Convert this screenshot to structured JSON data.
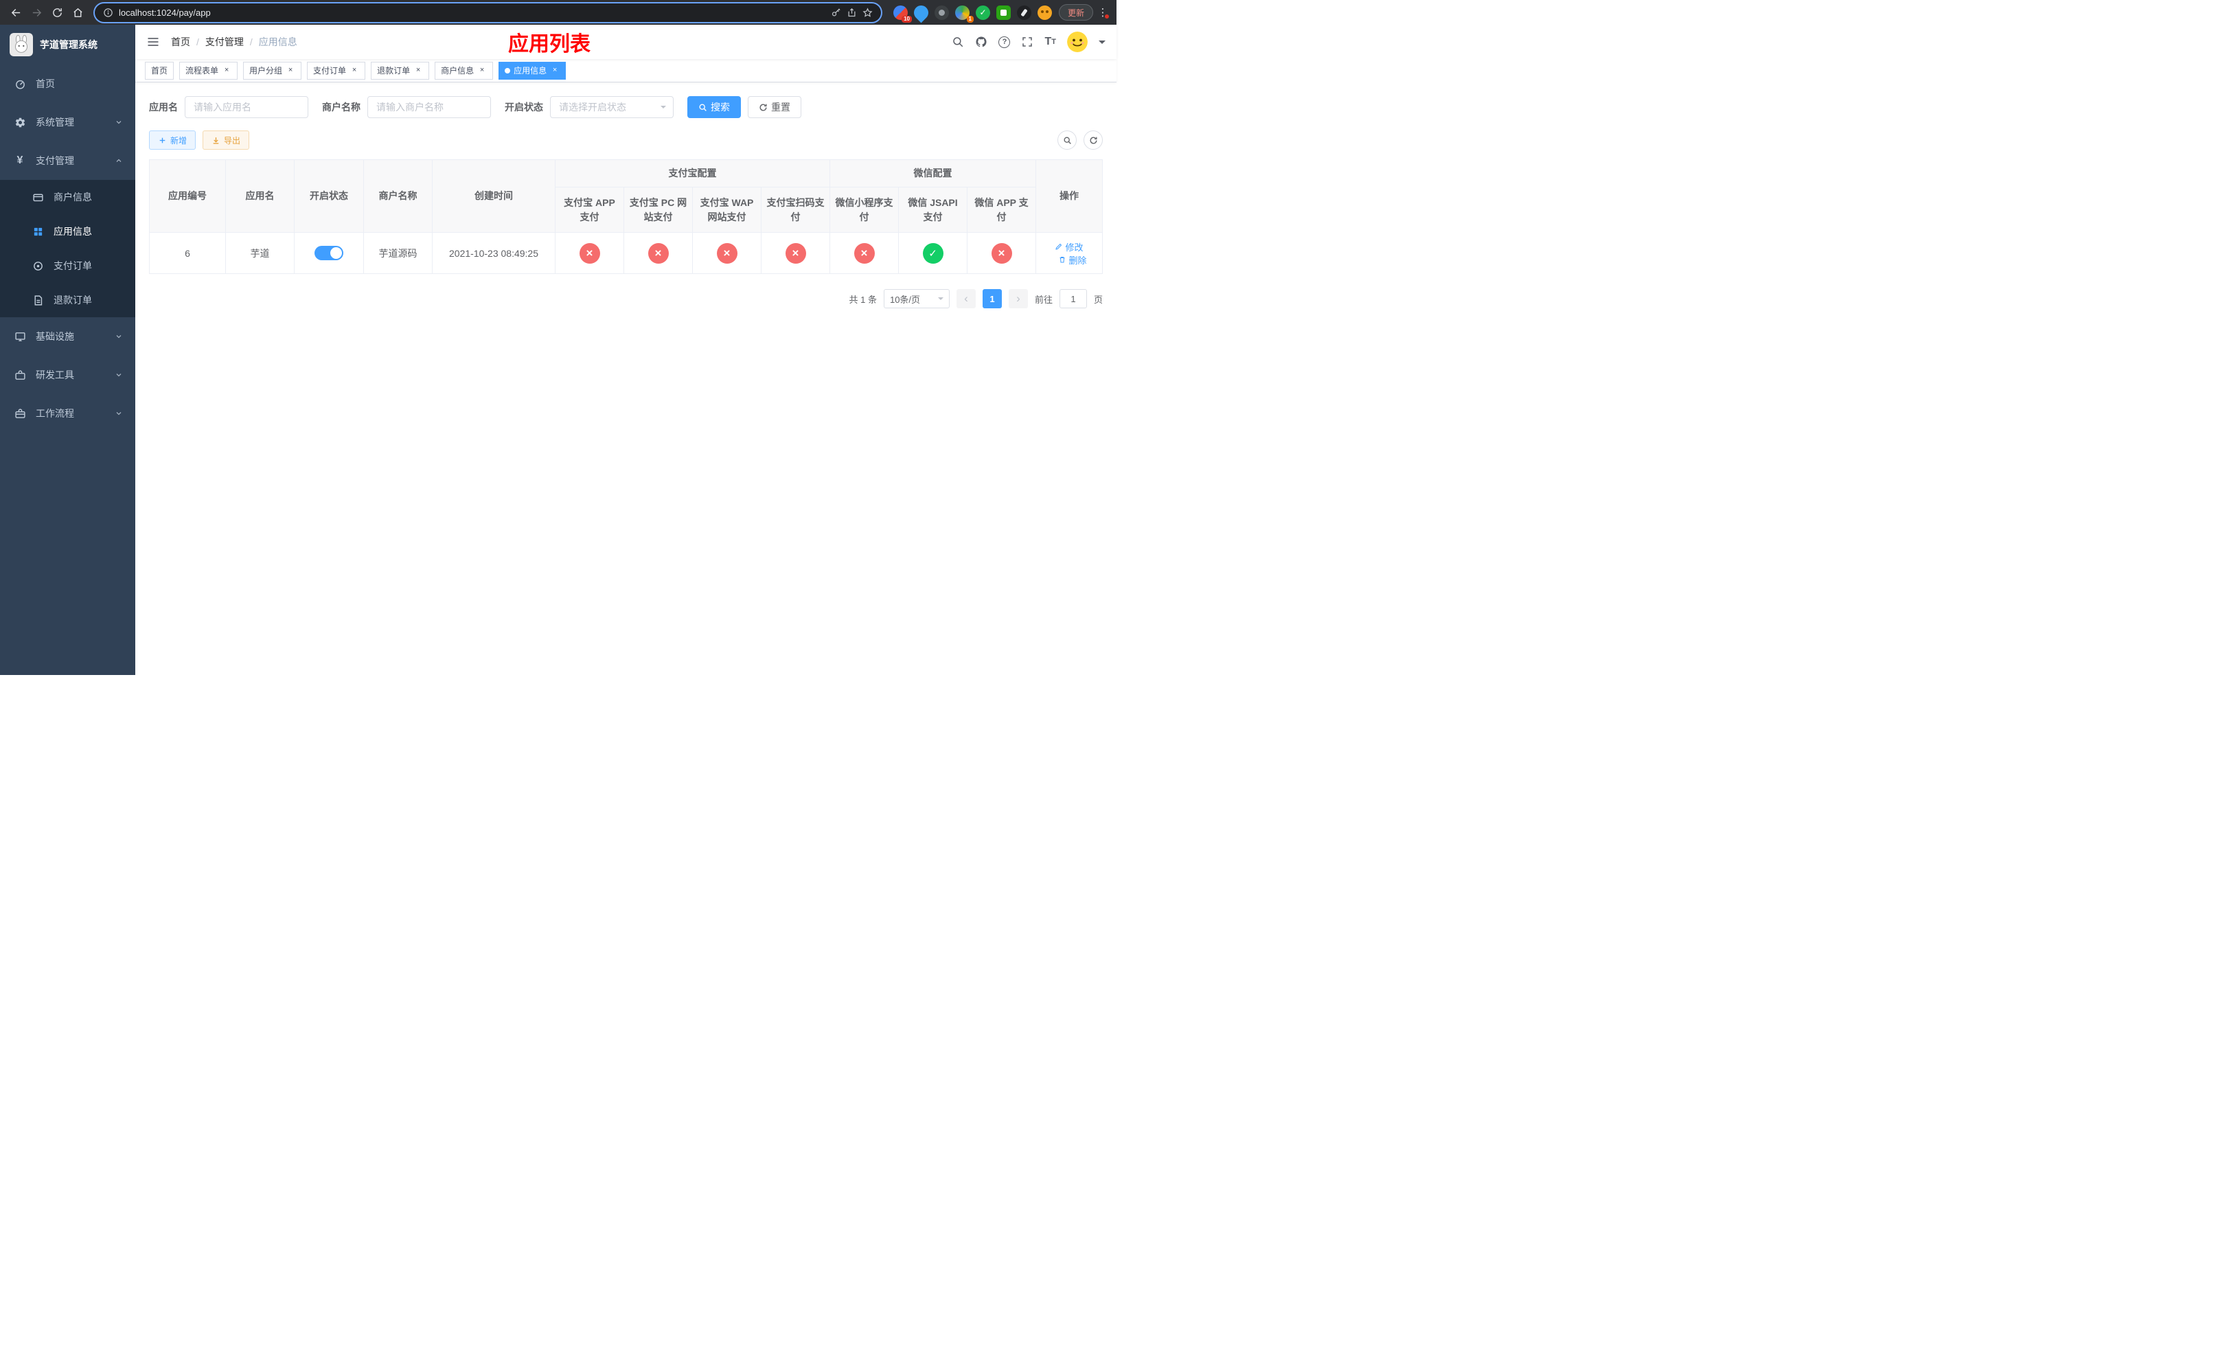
{
  "browser": {
    "url": "localhost:1024/pay/app",
    "update_button": "更新",
    "extension_badges": {
      "first": "10",
      "second": "1"
    }
  },
  "sidebar": {
    "app_title": "芋道管理系统",
    "menu": [
      {
        "label": "首页"
      },
      {
        "label": "系统管理"
      },
      {
        "label": "支付管理"
      },
      {
        "label": "基础设施"
      },
      {
        "label": "研发工具"
      },
      {
        "label": "工作流程"
      }
    ],
    "pay_submenu": [
      {
        "label": "商户信息"
      },
      {
        "label": "应用信息"
      },
      {
        "label": "支付订单"
      },
      {
        "label": "退款订单"
      }
    ]
  },
  "navbar": {
    "breadcrumb": [
      "首页",
      "支付管理",
      "应用信息"
    ],
    "page_title": "应用列表"
  },
  "tabs": [
    {
      "label": "首页"
    },
    {
      "label": "流程表单"
    },
    {
      "label": "用户分组"
    },
    {
      "label": "支付订单"
    },
    {
      "label": "退款订单"
    },
    {
      "label": "商户信息"
    },
    {
      "label": "应用信息"
    }
  ],
  "filters": {
    "app_name_label": "应用名",
    "app_name_placeholder": "请输入应用名",
    "merchant_label": "商户名称",
    "merchant_placeholder": "请输入商户名称",
    "status_label": "开启状态",
    "status_placeholder": "请选择开启状态",
    "search_button": "搜索",
    "reset_button": "重置"
  },
  "toolbar": {
    "add_button": "新增",
    "export_button": "导出"
  },
  "table": {
    "headers": {
      "app_id": "应用编号",
      "app_name": "应用名",
      "status": "开启状态",
      "merchant": "商户名称",
      "created": "创建时间",
      "alipay_group": "支付宝配置",
      "wechat_group": "微信配置",
      "alipay_app": "支付宝 APP 支付",
      "alipay_pc": "支付宝 PC 网站支付",
      "alipay_wap": "支付宝 WAP 网站支付",
      "alipay_qr": "支付宝扫码支付",
      "wx_mini": "微信小程序支付",
      "wx_jsapi": "微信 JSAPI 支付",
      "wx_app": "微信 APP 支付",
      "actions": "操作"
    },
    "rows": [
      {
        "app_id": "6",
        "app_name": "芋道",
        "switch": "on",
        "merchant": "芋道源码",
        "created": "2021-10-23 08:49:25",
        "alipay_app": "fail",
        "alipay_pc": "fail",
        "alipay_wap": "fail",
        "alipay_qr": "fail",
        "wx_mini": "fail",
        "wx_jsapi": "success",
        "wx_app": "fail",
        "edit_label": "修改",
        "delete_label": "删除"
      }
    ]
  },
  "pagination": {
    "total_text": "共 1 条",
    "page_size_text": "10条/页",
    "current_page": "1",
    "goto_prefix": "前往",
    "goto_value": "1",
    "goto_suffix": "页"
  },
  "icons": {
    "fail_icon": "×",
    "success_icon": "✓",
    "search_icon": "magnifier",
    "refresh_icon": "circular-arrow",
    "add_icon": "+",
    "export_icon": "download-arrow",
    "edit_icon": "pencil",
    "delete_icon": "trash"
  }
}
